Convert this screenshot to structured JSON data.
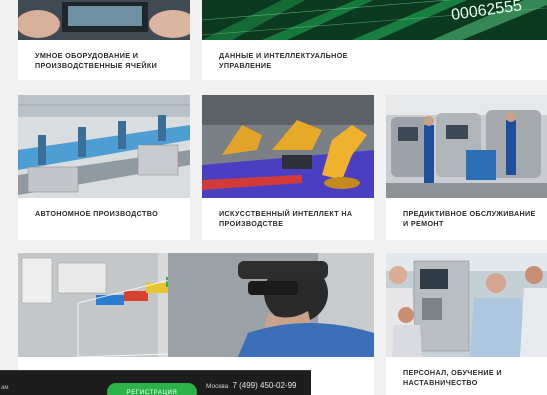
{
  "cards": {
    "smart_equipment": {
      "title": "Умное оборудование и\nпроизводственные ячейки"
    },
    "data_ai_management": {
      "title": "Данные и интеллектуальное\nуправление",
      "image_numbers": "00062555"
    },
    "autonomous_production": {
      "title": "Автономное производство"
    },
    "ai_production": {
      "title": "Искусственный интеллект на\nпроизводстве"
    },
    "predictive_maintenance": {
      "title": "Предиктивное обслуживание\nи ремонт"
    },
    "vr_training": {
      "title": ""
    },
    "staff_training": {
      "title": "Персонал, обучение и\nнаставничество"
    }
  },
  "bottom_bar": {
    "brand_fragment": "ам",
    "register_label": "Регистрация",
    "city": "Москва",
    "phone": "7 (499) 450-02-99"
  },
  "colors": {
    "background": "#f1f1f1",
    "card": "#ffffff",
    "accent_green": "#2bb34a",
    "bar": "#1d1d1d"
  }
}
